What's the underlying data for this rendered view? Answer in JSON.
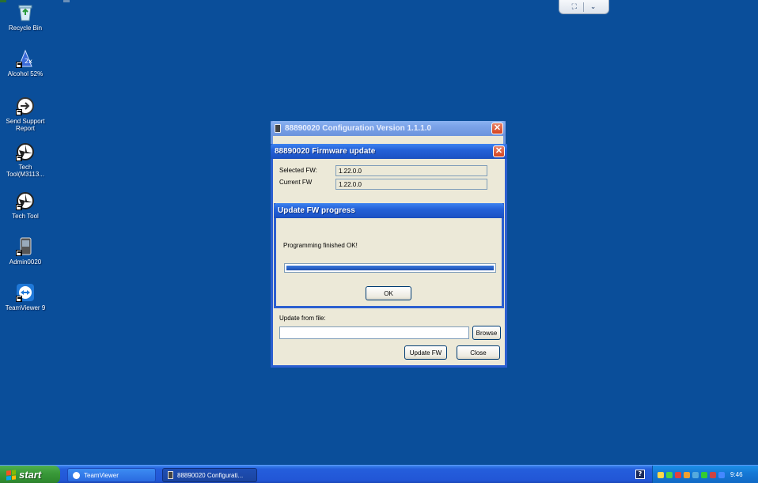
{
  "desktop": {
    "icons": [
      {
        "label": "Recycle Bin",
        "icon": "recycle-bin-icon"
      },
      {
        "label": "Alcohol 52%",
        "icon": "alcohol-icon"
      },
      {
        "label": "Send Support\nReport",
        "icon": "send-support-icon"
      },
      {
        "label": "Tech\nTool(M3113...",
        "icon": "tech-tool-icon"
      },
      {
        "label": "Tech Tool",
        "icon": "tech-tool-icon"
      },
      {
        "label": "Admin0020",
        "icon": "admin-icon"
      },
      {
        "label": "TeamViewer 9",
        "icon": "teamviewer-icon"
      }
    ]
  },
  "config_window": {
    "title": "88890020 Configuration Version 1.1.1.0",
    "close": "✕"
  },
  "fw_window": {
    "title": "88890020 Firmware update",
    "close": "✕",
    "selected_fw_label": "Selected FW:",
    "selected_fw_value": "1.22.0.0",
    "current_fw_label": "Current FW",
    "current_fw_value": "1.22.0.0",
    "update_from_file_label": "Update from file:",
    "file_path_value": "",
    "browse_label": "Browse",
    "update_fw_label": "Update FW",
    "close_label": "Close"
  },
  "progress_dialog": {
    "title": "Update FW progress",
    "message": "Programming finished OK!",
    "progress": 1.0,
    "ok_label": "OK"
  },
  "taskbar": {
    "start_label": "start",
    "items": [
      {
        "label": "TeamViewer"
      },
      {
        "label": "88890020 Configurati..."
      }
    ],
    "clock": "9:46"
  },
  "colors": {
    "desktop": "#0a4e9a",
    "title_active": "#2461d8",
    "progress_fill": "#2a62c8"
  }
}
